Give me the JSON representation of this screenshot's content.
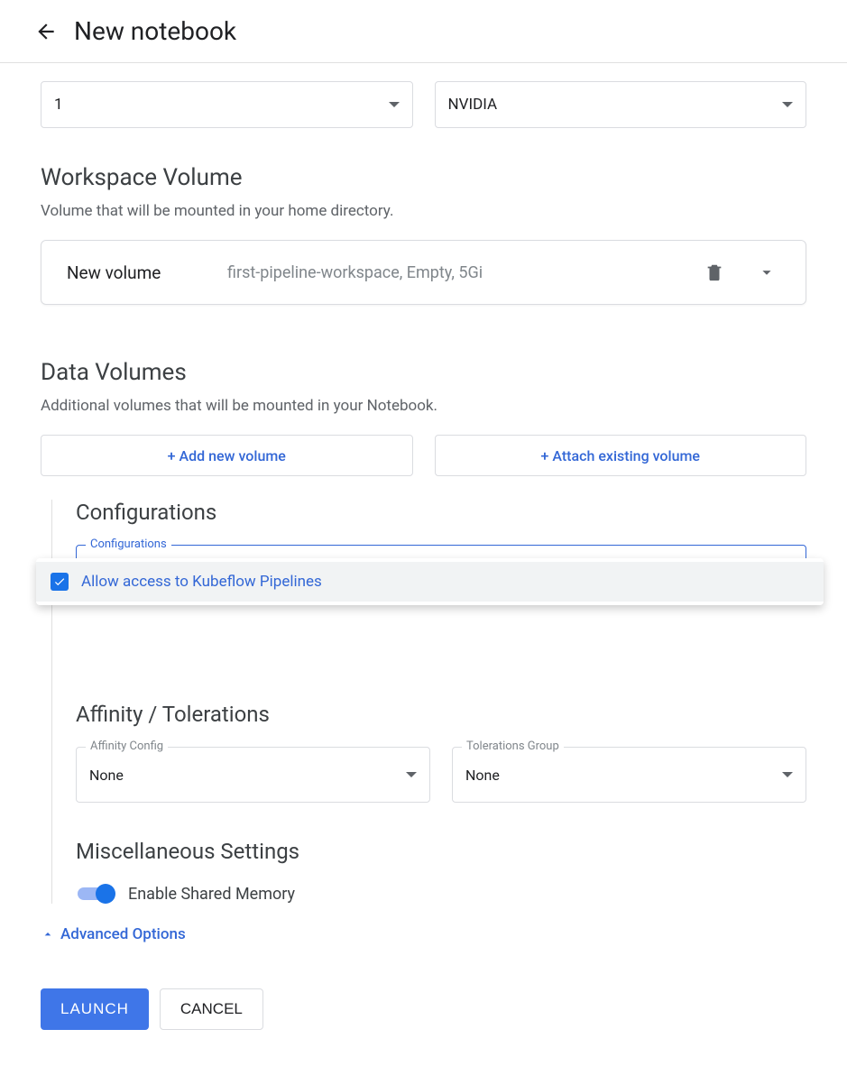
{
  "header": {
    "title": "New notebook"
  },
  "top": {
    "count": "1",
    "vendor": "NVIDIA"
  },
  "workspace": {
    "title": "Workspace Volume",
    "desc": "Volume that will be mounted in your home directory.",
    "card": {
      "label": "New volume",
      "summary": "first-pipeline-workspace, Empty, 5Gi"
    }
  },
  "datavol": {
    "title": "Data Volumes",
    "desc": "Additional volumes that will be mounted in your Notebook.",
    "add_btn": "+ Add new volume",
    "attach_btn": "+ Attach existing volume"
  },
  "configs": {
    "title": "Configurations",
    "field_label": "Configurations",
    "option": "Allow access to Kubeflow Pipelines"
  },
  "affinity": {
    "title": "Affinity / Tolerations",
    "affinity_label": "Affinity Config",
    "affinity_value": "None",
    "tolerations_label": "Tolerations Group",
    "tolerations_value": "None"
  },
  "misc": {
    "title": "Miscellaneous Settings",
    "shm_label": "Enable Shared Memory"
  },
  "advanced_link": "Advanced Options",
  "footer": {
    "launch": "LAUNCH",
    "cancel": "CANCEL"
  }
}
